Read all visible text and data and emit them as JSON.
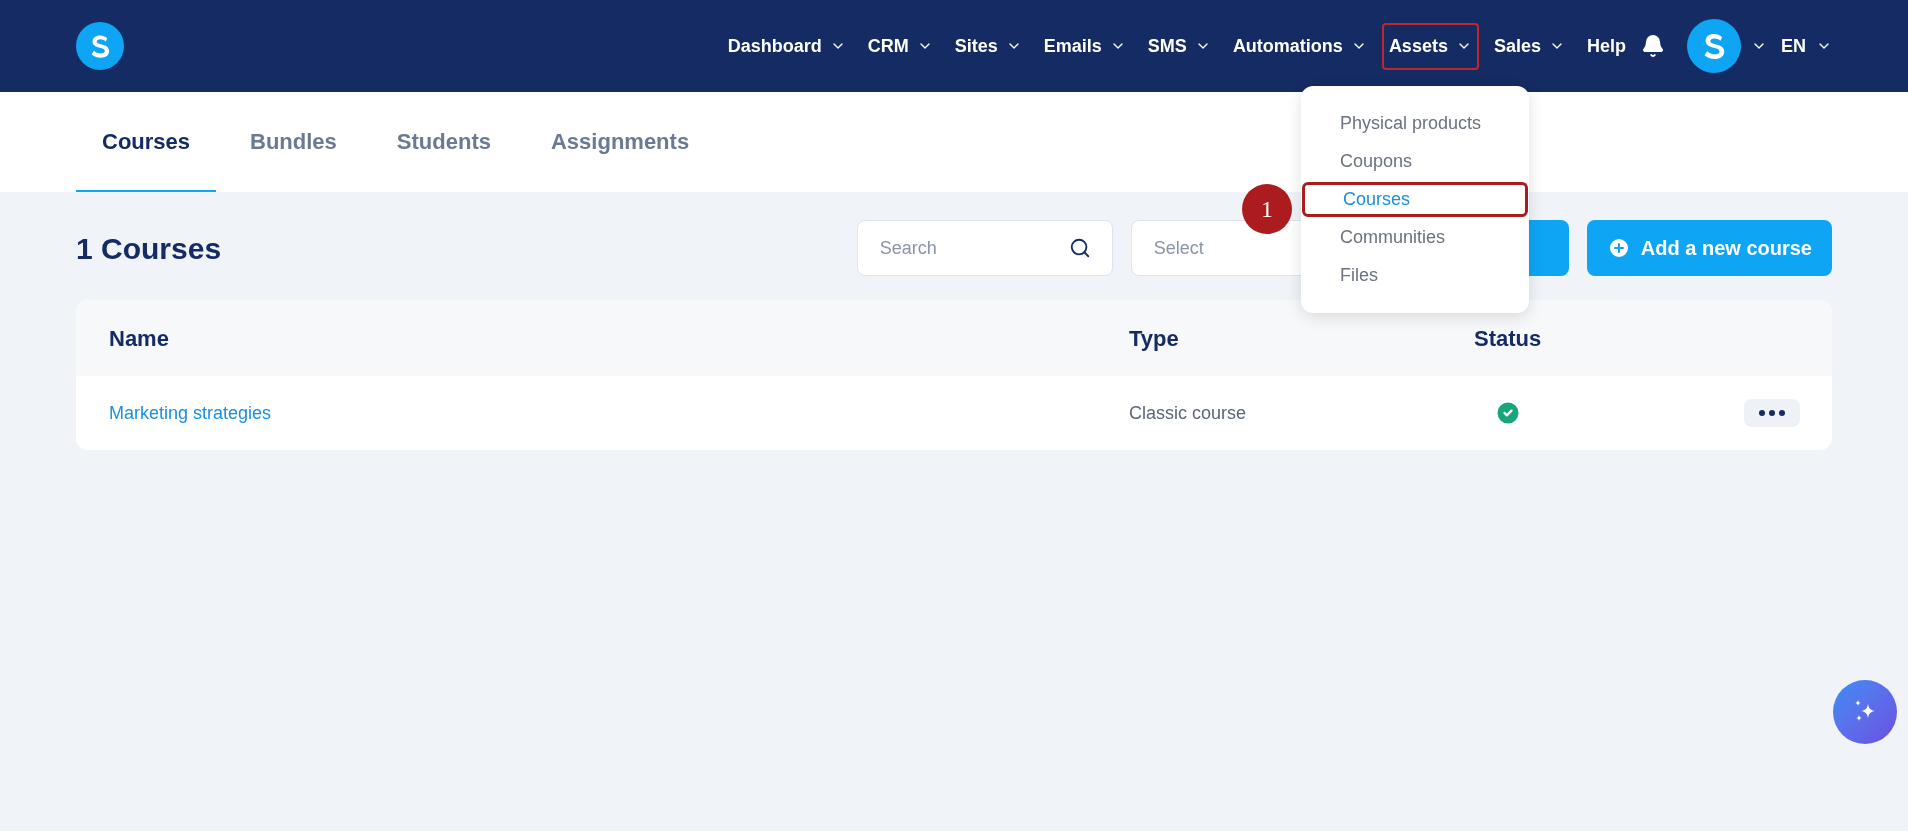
{
  "nav": {
    "items": [
      {
        "label": "Dashboard",
        "has_menu": true,
        "highlighted": false
      },
      {
        "label": "CRM",
        "has_menu": true,
        "highlighted": false
      },
      {
        "label": "Sites",
        "has_menu": true,
        "highlighted": false
      },
      {
        "label": "Emails",
        "has_menu": true,
        "highlighted": false
      },
      {
        "label": "SMS",
        "has_menu": true,
        "highlighted": false
      },
      {
        "label": "Automations",
        "has_menu": true,
        "highlighted": false
      },
      {
        "label": "Assets",
        "has_menu": true,
        "highlighted": true
      },
      {
        "label": "Sales",
        "has_menu": true,
        "highlighted": false
      },
      {
        "label": "Help",
        "has_menu": false,
        "highlighted": false
      }
    ],
    "language": "EN"
  },
  "dropdown": {
    "items": [
      {
        "label": "Physical products",
        "selected": false,
        "highlighted": false
      },
      {
        "label": "Coupons",
        "selected": false,
        "highlighted": false
      },
      {
        "label": "Courses",
        "selected": true,
        "highlighted": true
      },
      {
        "label": "Communities",
        "selected": false,
        "highlighted": false
      },
      {
        "label": "Files",
        "selected": false,
        "highlighted": false
      }
    ],
    "step_marker": "1"
  },
  "tabs": [
    {
      "label": "Courses",
      "selected": true
    },
    {
      "label": "Bundles",
      "selected": false
    },
    {
      "label": "Students",
      "selected": false
    },
    {
      "label": "Assignments",
      "selected": false
    }
  ],
  "heading": "1 Courses",
  "search": {
    "placeholder": "Search"
  },
  "select": {
    "placeholder": "Select"
  },
  "add_button": "Add a new course",
  "table": {
    "columns": [
      "Name",
      "Type",
      "Status"
    ],
    "rows": [
      {
        "name": "Marketing strategies",
        "type": "Classic course",
        "published": true
      }
    ]
  }
}
